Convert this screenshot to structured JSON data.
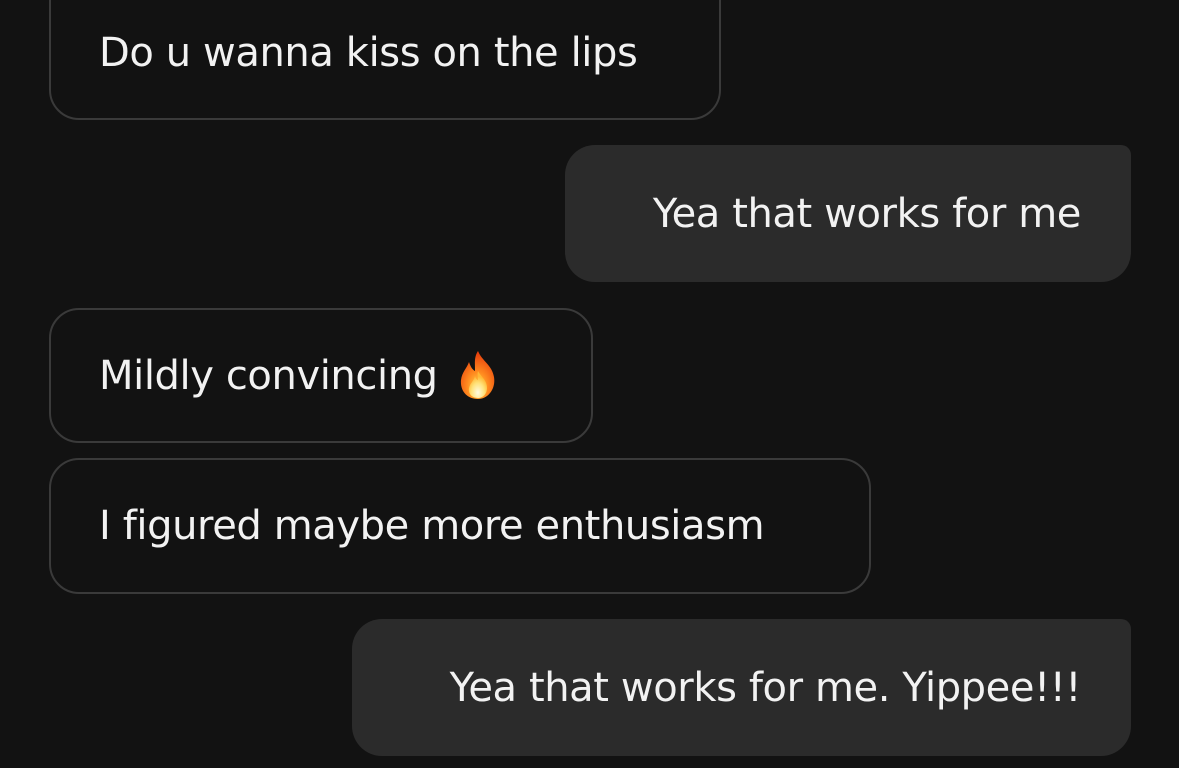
{
  "messages": [
    {
      "direction": "incoming",
      "text": "Do u wanna kiss on the lips"
    },
    {
      "direction": "outgoing",
      "text": "Yea that works for me"
    },
    {
      "direction": "incoming",
      "text": "Mildly convincing",
      "emoji": "fire-emoji"
    },
    {
      "direction": "incoming",
      "text": "I figured maybe more enthusiasm"
    },
    {
      "direction": "outgoing",
      "text": "Yea that works for me. Yippee!!!"
    }
  ],
  "colors": {
    "background": "#121212",
    "incoming_border": "#3a3a3a",
    "outgoing_bubble": "#2b2b2b",
    "text": "#f2f2f2"
  }
}
